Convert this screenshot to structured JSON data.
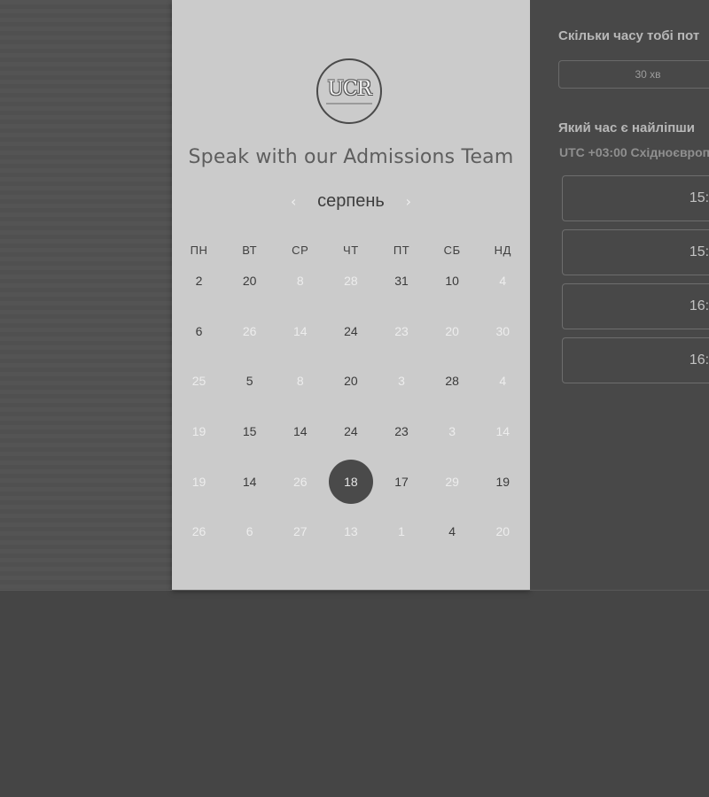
{
  "calendar": {
    "logo_text": "UCR",
    "title": "Speak with our Admissions Team",
    "month": "серпень",
    "prev_icon": "chevron-left-icon",
    "next_icon": "chevron-right-icon",
    "weekdays": [
      "ПН",
      "ВТ",
      "СР",
      "ЧТ",
      "ПТ",
      "СБ",
      "НД"
    ],
    "days": [
      "2",
      "20",
      "8",
      "28",
      "31",
      "10",
      "4",
      "6",
      "26",
      "14",
      "24",
      "23",
      "20",
      "30",
      "25",
      "5",
      "8",
      "20",
      "3",
      "28",
      "4",
      "19",
      "15",
      "14",
      "24",
      "23",
      "3",
      "14",
      "19",
      "14",
      "26",
      "18",
      "17",
      "29",
      "19",
      "26",
      "6",
      "27",
      "13",
      "1",
      "4",
      "20"
    ],
    "unavailable_days": [
      2,
      3,
      6,
      8,
      9,
      11,
      12,
      13,
      14,
      16,
      18,
      20,
      21,
      26,
      27,
      28,
      30,
      33,
      35,
      36,
      37,
      38,
      39,
      41
    ],
    "selected_day_index": 31
  },
  "booking": {
    "duration_label": "Скільки часу тобі пот",
    "duration_value": "30 хв",
    "time_label": "Який час є найліпши",
    "timezone": "UTC +03:00 Східноєвроп",
    "slots": [
      "15:",
      "15:",
      "16:",
      "16:"
    ]
  },
  "colors": {
    "background": "#454545",
    "card": "#cbcbcb",
    "selected_day": "#4a4a4a"
  }
}
